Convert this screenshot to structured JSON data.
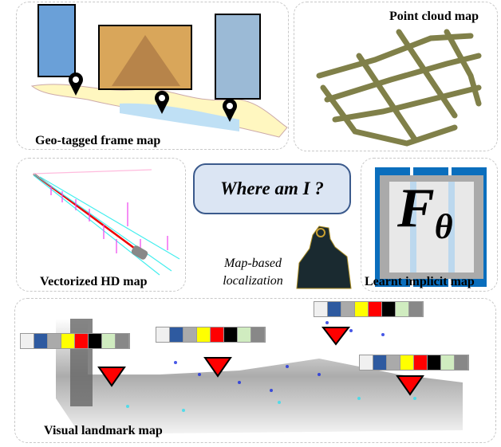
{
  "panels": {
    "geo": {
      "label": "Geo-tagged frame map"
    },
    "pointcloud": {
      "label": "Point cloud map"
    },
    "hd": {
      "label": "Vectorized HD map"
    },
    "implicit": {
      "label": "Learnt implicit map",
      "symbol": "F",
      "subscript": "θ"
    },
    "landmark": {
      "label": "Visual landmark map"
    }
  },
  "center": {
    "question": "Where am I ?",
    "caption_line1": "Map-based",
    "caption_line2": "localization"
  },
  "colors": {
    "descriptor": [
      "#f0f0f0",
      "#2e5aa0",
      "#aaaaaa",
      "#ffff00",
      "#ff0000",
      "#000000",
      "#d0ecc0",
      "#888888"
    ],
    "implicit_blue": "#0a6ebd",
    "pointcloud": "#6b6a2a",
    "marker": "#ff0000"
  }
}
